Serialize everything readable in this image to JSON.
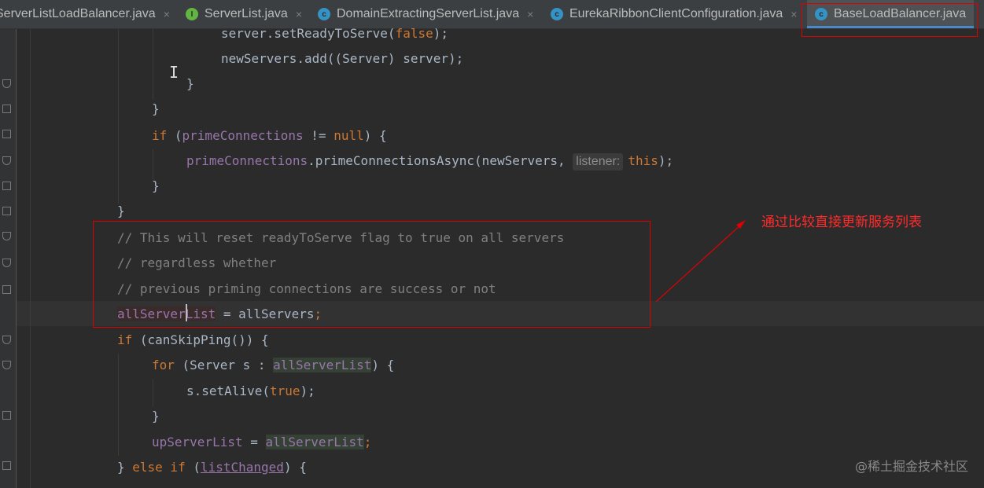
{
  "tabs": [
    {
      "label": "ServerListLoadBalancer.java",
      "icon": "class-icon",
      "active": false
    },
    {
      "label": "ServerList.java",
      "icon": "interface-icon",
      "active": false
    },
    {
      "label": "DomainExtractingServerList.java",
      "icon": "class-icon",
      "active": false
    },
    {
      "label": "EurekaRibbonClientConfiguration.java",
      "icon": "class-icon",
      "active": false
    },
    {
      "label": "BaseLoadBalancer.java",
      "icon": "class-icon",
      "active": true
    }
  ],
  "tab_close": "×",
  "icon_letters": {
    "class": "c",
    "interface": "I"
  },
  "code": {
    "l1": {
      "a": "server.setReadyToServe(",
      "b": "false",
      "c": ");"
    },
    "l2": {
      "a": "newServers.add((Server) server);"
    },
    "l3": {
      "a": "}"
    },
    "l4": {
      "a": "}"
    },
    "l5": {
      "kw": "if",
      "a": " (",
      "f": "primeConnections",
      "b": " != ",
      "kw2": "null",
      "c": ") {"
    },
    "l6": {
      "f": "primeConnections",
      "a": ".primeConnectionsAsync(newServers, ",
      "hint": "listener:",
      "kw": "this",
      "c": ");"
    },
    "l7": {
      "a": "}"
    },
    "l8": {
      "a": "}"
    },
    "l9": {
      "cm": "// This will reset readyToServe flag to true on all servers"
    },
    "l10": {
      "cm": "// regardless whether"
    },
    "l11": {
      "cm": "// previous priming connections are success or not"
    },
    "l12": {
      "f": "allServerList",
      "a": " = allServers",
      "c": ";"
    },
    "l13": {
      "kw": "if",
      "a": " (canSkipPing()) {"
    },
    "l14": {
      "kw": "for",
      "a": " (Server s : ",
      "f": "allServerList",
      "c": ") {"
    },
    "l15": {
      "a": "s.setAlive(",
      "kw": "true",
      "c": ");"
    },
    "l16": {
      "a": "}"
    },
    "l17": {
      "f": "upServerList",
      "a": " = ",
      "f2": "allServerList",
      "c": ";"
    },
    "l18": {
      "a": "} ",
      "kw": "else if",
      "b": " (",
      "u": "listChanged",
      "c": ") {"
    }
  },
  "annotation": "通过比较直接更新服务列表",
  "watermark": "@稀土掘金技术社区",
  "colors": {
    "keyword": "#cc7832",
    "field": "#9876aa",
    "comment": "#808080",
    "text": "#a9b7c6",
    "annotation": "#ff2a2a"
  }
}
